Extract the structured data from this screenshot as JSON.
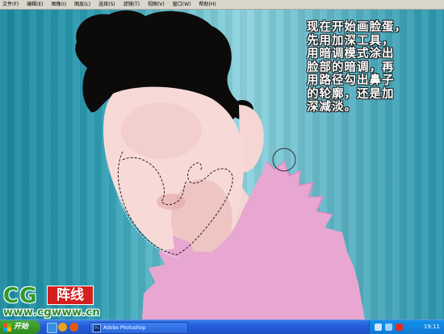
{
  "menu": [
    "文件(F)",
    "编辑(E)",
    "图像(I)",
    "图层(L)",
    "选择(S)",
    "滤镜(T)",
    "视图(V)",
    "窗口(W)",
    "帮助(H)"
  ],
  "caption": {
    "lines": [
      "现在开始画脸蛋，",
      "先用加深工具，",
      "用暗调模式涂出",
      "脸部的暗调，再",
      "用路径勾出鼻子",
      "的轮廓，还是加",
      "深减淡。"
    ]
  },
  "logo": {
    "cg": "CG",
    "badge": "阵线",
    "url": "www.cgwww.cn"
  },
  "taskbar": {
    "start_label": "开始",
    "task_label": "Adobe Photoshop",
    "task_icon": "Ps",
    "clock": "19:11"
  },
  "colors": {
    "skin": "#f6d9d6",
    "skin_shadow": "#e8b5b3",
    "hair": "#0d0a0a",
    "dress": "#e7a7d1",
    "taskbar": "#245edb",
    "start": "#3c9a2e"
  },
  "icons": [
    "windows-flag-icon",
    "ie-icon",
    "media-player-icon",
    "firefox-icon",
    "photoshop-icon",
    "volume-icon",
    "network-icon",
    "shield-icon"
  ]
}
